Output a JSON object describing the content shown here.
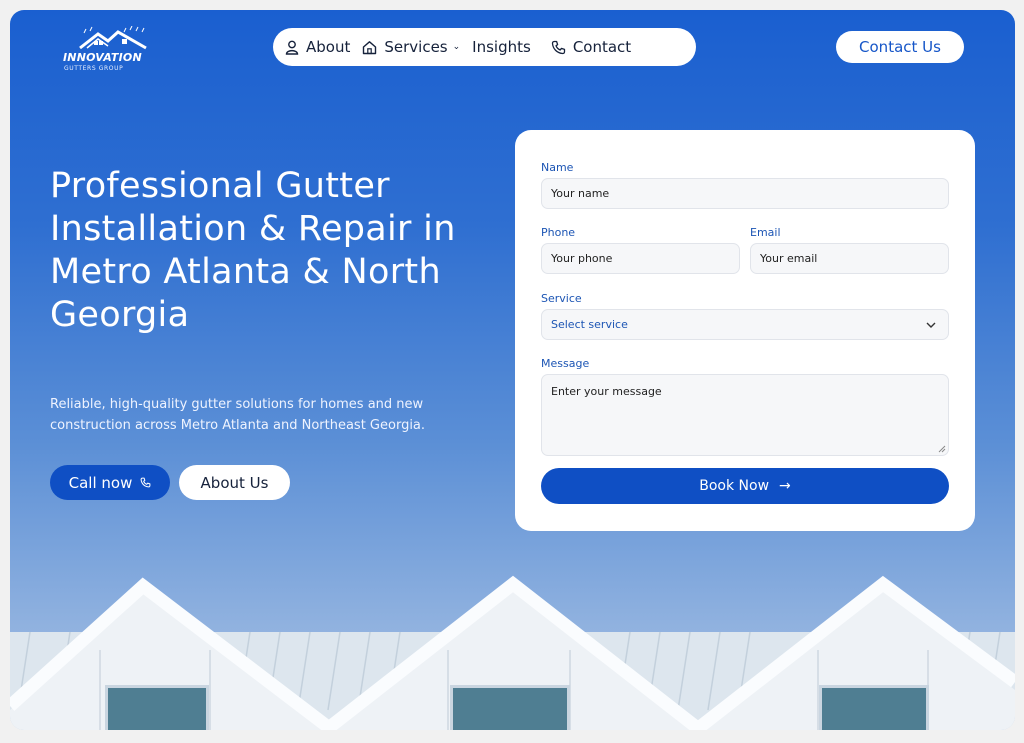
{
  "brand": {
    "name": "INNOVATION",
    "tagline": "GUTTERS GROUP"
  },
  "nav": {
    "items": [
      {
        "label": "About",
        "icon": "user-icon"
      },
      {
        "label": "Services",
        "icon": "home-icon",
        "chevron": "⌄"
      },
      {
        "label": "Insights"
      },
      {
        "label": "Contact",
        "icon": "phone-icon"
      }
    ],
    "cta": "Contact Us"
  },
  "hero": {
    "title": "Professional Gutter Installation & Repair in Metro Atlanta & North Georgia",
    "description": "Reliable, high-quality gutter solutions for homes and new construction across Metro Atlanta and Northeast Georgia.",
    "call_label": "Call now",
    "about_label": "About Us"
  },
  "form": {
    "name_label": "Name",
    "name_placeholder": "Your name",
    "phone_label": "Phone",
    "phone_placeholder": "Your phone",
    "email_label": "Email",
    "email_placeholder": "Your email",
    "service_label": "Service",
    "service_value": "Select service",
    "message_label": "Message",
    "message_placeholder": "Enter your message",
    "submit_label": "Book Now",
    "submit_arrow": "→"
  },
  "colors": {
    "primary": "#0f4fc4",
    "label_blue": "#1c55b4",
    "hero_top": "#1a5fd0",
    "hero_bottom": "#a8c1e4"
  }
}
